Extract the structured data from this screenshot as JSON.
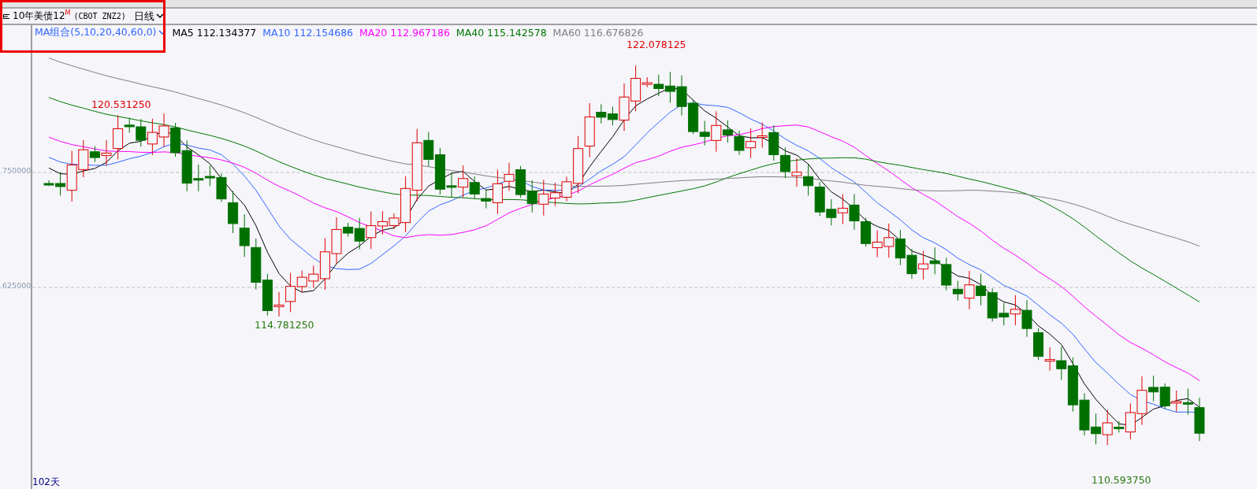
{
  "toolbar": {
    "instrument": "10年美债12",
    "superscript": "M",
    "code": "(CBOT ZNZ2)",
    "period": "日线"
  },
  "indicator": {
    "name": "MA组合(5,10,20,40,60,0)",
    "values": [
      {
        "label": "MA5 112.134377",
        "color": "#000000"
      },
      {
        "label": "MA10 112.154686",
        "color": "#3366ff"
      },
      {
        "label": "MA20 112.967186",
        "color": "#ff00ff"
      },
      {
        "label": "MA40 115.142578",
        "color": "#007700"
      },
      {
        "label": "MA60 116.676826",
        "color": "#808080"
      }
    ]
  },
  "axis": {
    "ticks": [
      ".750000",
      ".625000"
    ]
  },
  "price_marks": [
    {
      "text": "120.531250",
      "kind": "high"
    },
    {
      "text": "122.078125",
      "kind": "high"
    },
    {
      "text": "114.781250",
      "kind": "low"
    },
    {
      "text": "110.593750",
      "kind": "low"
    }
  ],
  "footer": {
    "count": "102天"
  },
  "highlight_frame": true
}
